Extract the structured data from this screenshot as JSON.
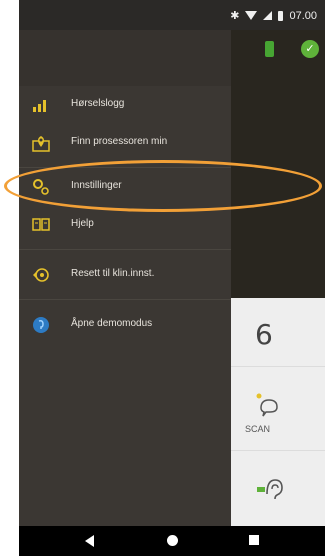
{
  "status_bar": {
    "time": "07.00",
    "icons": [
      "bluetooth-icon",
      "wifi-icon",
      "signal-icon",
      "battery-icon"
    ]
  },
  "drawer": {
    "items": [
      {
        "label": "Hørselslogg",
        "icon": "bar-chart-icon"
      },
      {
        "label": "Finn prosessoren min",
        "icon": "map-pin-icon"
      },
      {
        "label": "Innstillinger",
        "icon": "gears-icon"
      },
      {
        "label": "Hjelp",
        "icon": "book-icon"
      },
      {
        "label": "Resett til klin.innst.",
        "icon": "reset-icon"
      },
      {
        "label": "Åpne demomodus",
        "icon": "demo-icon"
      }
    ]
  },
  "background_app": {
    "number": "6",
    "scan_label": "SCAN"
  },
  "colors": {
    "drawer_bg": "#3b3733",
    "accent_yellow": "#e5c12b",
    "annotation": "#f2a037",
    "status_green": "#47a533"
  }
}
